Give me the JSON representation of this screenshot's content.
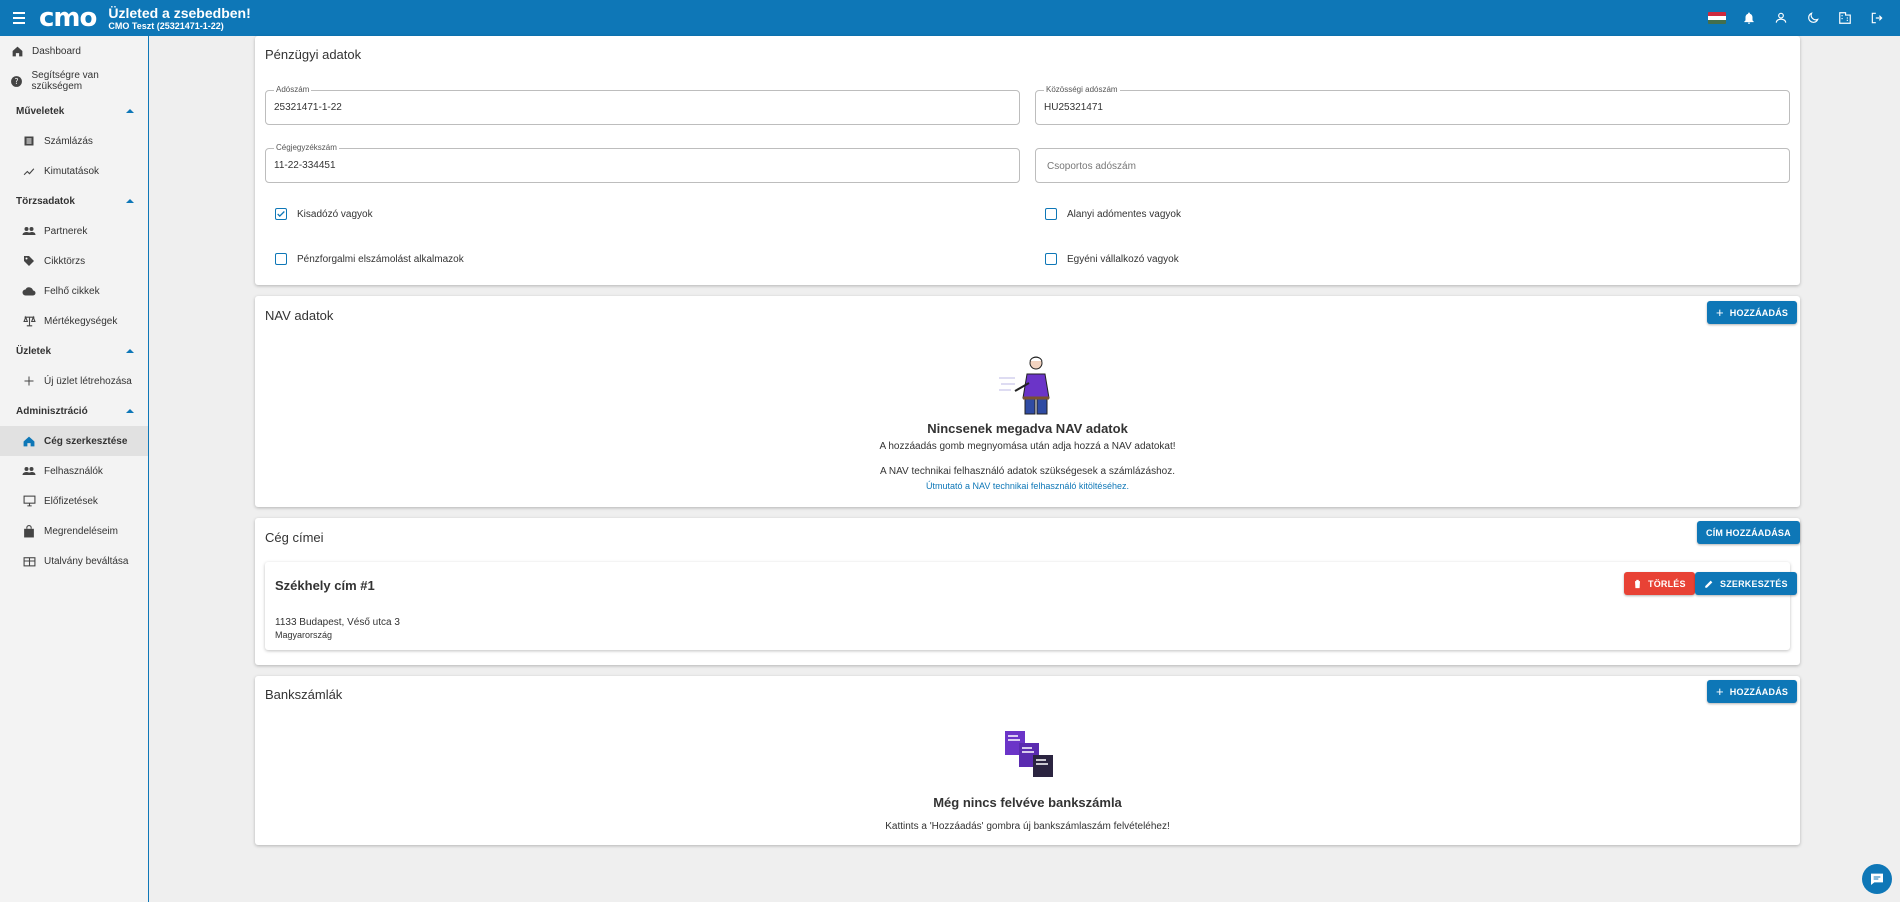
{
  "topbar": {
    "logo": "cmo",
    "title": "Üzleted a zsebedben!",
    "subtitle": "CMO Teszt (25321471-1-22)",
    "icons": [
      "hungarian-flag",
      "bell-icon",
      "user-icon",
      "moon-icon",
      "building-icon",
      "logout-icon"
    ]
  },
  "sidebar": {
    "dashboard": "Dashboard",
    "help": "Segítségre van szükségem",
    "sections": {
      "muveletek": "Műveletek",
      "torzsadatok": "Törzsadatok",
      "uzletek": "Üzletek",
      "adminisztracio": "Adminisztráció"
    },
    "items": {
      "szamlazas": "Számlázás",
      "kimutatasok": "Kimutatások",
      "partnerek": "Partnerek",
      "cikktorzs": "Cikktörzs",
      "felho": "Felhő cikkek",
      "mertekegysegek": "Mértékegységek",
      "uj_uzlet": "Új üzlet létrehozása",
      "ceg": "Cég szerkesztése",
      "felhasznalok": "Felhasználók",
      "elofizetesek": "Előfizetések",
      "megrendeleseim": "Megrendeléseim",
      "utalvany": "Utalvány beváltása"
    }
  },
  "financial": {
    "title": "Pénzügyi adatok",
    "tax_label": "Adószám",
    "tax_value": "25321471-1-22",
    "community_label": "Közösségi adószám",
    "community_value": "HU25321471",
    "reg_label": "Cégjegyzékszám",
    "reg_value": "11-22-334451",
    "group_placeholder": "Csoportos adószám",
    "checks": {
      "kisadozo": "Kisadózó vagyok",
      "alanyi": "Alanyi adómentes vagyok",
      "penzforgalmi": "Pénzforgalmi elszámolást alkalmazok",
      "egyeni": "Egyéni vállalkozó vagyok"
    }
  },
  "nav": {
    "title": "NAV adatok",
    "add_button": "HOZZÁADÁS",
    "empty_title": "Nincsenek megadva NAV adatok",
    "empty_text1": "A hozzáadás gomb megnyomása után adja hozzá a NAV adatokat!",
    "empty_text2": "A NAV technikai felhasználó adatok szükségesek a számlázáshoz.",
    "guide_link": "Útmutató a NAV technikai felhasználó kitöltéséhez."
  },
  "addresses": {
    "title": "Cég címei",
    "add_button": "CÍM HOZZÁADÁSA",
    "card_title": "Székhely cím #1",
    "delete_button": "TÖRLÉS",
    "edit_button": "SZERKESZTÉS",
    "line1": "1133 Budapest, Véső utca 3",
    "line2": "Magyarország"
  },
  "bank": {
    "title": "Bankszámlák",
    "add_button": "HOZZÁADÁS",
    "empty_title": "Még nincs felvéve bankszámla",
    "empty_text": "Kattints a 'Hozzáadás' gombra új bankszámlaszám felvételéhez!"
  },
  "colors": {
    "primary": "#0e77b7",
    "danger": "#e84235"
  }
}
